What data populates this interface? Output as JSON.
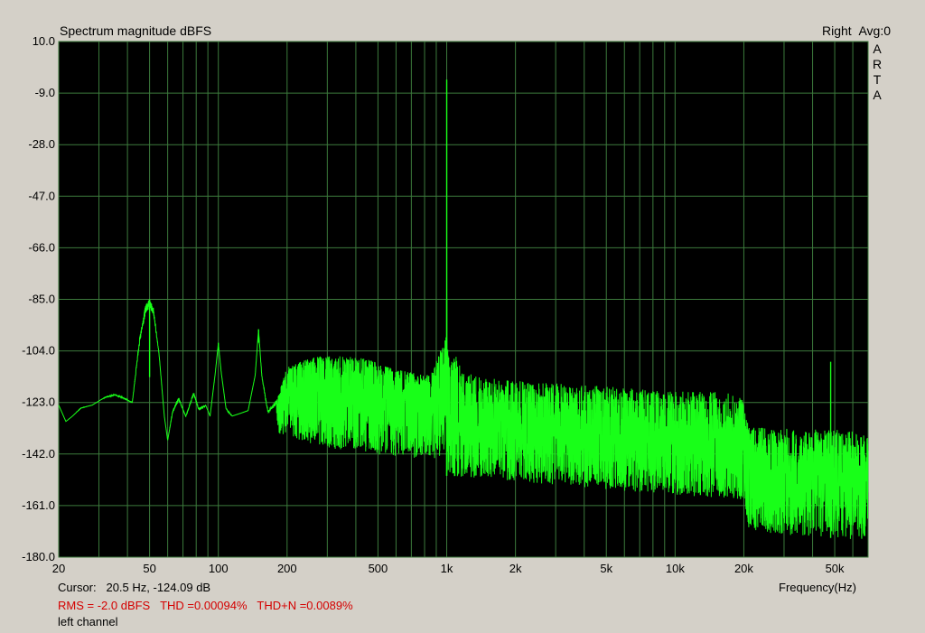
{
  "header": {
    "title": "Spectrum magnitude dBFS",
    "channel": "Right",
    "avg": "Avg:0",
    "brand_letters": [
      "A",
      "R",
      "T",
      "A"
    ]
  },
  "footer": {
    "cursor_label": "Cursor:",
    "cursor_value": "20.5 Hz, -124.09 dB",
    "rms": "RMS =   -2.0 dBFS",
    "thd": "THD =0.00094%",
    "thdn": "THD+N =0.0089%",
    "channel_label": "left channel"
  },
  "colors": {
    "plot_background": "#000000",
    "grid": "#3c7a3c",
    "trace": "#18ff18",
    "stats_text": "#d40000",
    "window_background": "#d4d0c8"
  },
  "chart_data": {
    "type": "line",
    "title": "Spectrum magnitude dBFS",
    "xlabel": "Frequency(Hz)",
    "ylabel": "",
    "x_scale": "log",
    "xlim": [
      20,
      70000
    ],
    "ylim": [
      -180,
      10
    ],
    "grid": true,
    "x_ticks": [
      {
        "value": 20,
        "label": "20"
      },
      {
        "value": 50,
        "label": "50"
      },
      {
        "value": 100,
        "label": "100"
      },
      {
        "value": 200,
        "label": "200"
      },
      {
        "value": 500,
        "label": "500"
      },
      {
        "value": 1000,
        "label": "1k"
      },
      {
        "value": 2000,
        "label": "2k"
      },
      {
        "value": 5000,
        "label": "5k"
      },
      {
        "value": 10000,
        "label": "10k"
      },
      {
        "value": 20000,
        "label": "20k"
      },
      {
        "value": 50000,
        "label": "50k"
      }
    ],
    "y_ticks": [
      {
        "value": 10,
        "label": "10.0"
      },
      {
        "value": -9,
        "label": "-9.0"
      },
      {
        "value": -28,
        "label": "-28.0"
      },
      {
        "value": -47,
        "label": "-47.0"
      },
      {
        "value": -66,
        "label": "-66.0"
      },
      {
        "value": -85,
        "label": "-85.0"
      },
      {
        "value": -104,
        "label": "-104.0"
      },
      {
        "value": -123,
        "label": "-123.0"
      },
      {
        "value": -142,
        "label": "-142.0"
      },
      {
        "value": -161,
        "label": "-161.0"
      },
      {
        "value": -180,
        "label": "-180.0"
      }
    ],
    "envelope": [
      [
        20,
        -124
      ],
      [
        21.5,
        -130
      ],
      [
        23,
        -128
      ],
      [
        25,
        -125
      ],
      [
        28,
        -124
      ],
      [
        32,
        -121
      ],
      [
        35,
        -120
      ],
      [
        38,
        -121
      ],
      [
        42,
        -123
      ],
      [
        45,
        -100
      ],
      [
        48,
        -87
      ],
      [
        50,
        -85
      ],
      [
        52,
        -88
      ],
      [
        55,
        -105
      ],
      [
        58,
        -128
      ],
      [
        60,
        -137
      ],
      [
        63,
        -126
      ],
      [
        67,
        -121
      ],
      [
        72,
        -128
      ],
      [
        78,
        -119
      ],
      [
        82,
        -125
      ],
      [
        88,
        -124
      ],
      [
        92,
        -128
      ],
      [
        97,
        -112
      ],
      [
        100,
        -101
      ],
      [
        103,
        -112
      ],
      [
        108,
        -125
      ],
      [
        115,
        -128
      ],
      [
        125,
        -127
      ],
      [
        135,
        -126
      ],
      [
        145,
        -113
      ],
      [
        150,
        -96
      ],
      [
        155,
        -113
      ],
      [
        165,
        -126
      ],
      [
        180,
        -122
      ],
      [
        200,
        -110
      ],
      [
        230,
        -108
      ],
      [
        270,
        -106
      ],
      [
        320,
        -106
      ],
      [
        380,
        -106
      ],
      [
        450,
        -107
      ],
      [
        550,
        -110
      ],
      [
        700,
        -112
      ],
      [
        850,
        -113
      ],
      [
        1000,
        -98
      ],
      [
        1150,
        -110
      ],
      [
        1500,
        -114
      ],
      [
        2000,
        -115
      ],
      [
        3000,
        -116
      ],
      [
        5000,
        -117
      ],
      [
        10000,
        -119
      ],
      [
        15000,
        -119
      ],
      [
        19500,
        -120
      ],
      [
        21000,
        -132
      ],
      [
        25000,
        -132
      ],
      [
        40000,
        -133
      ],
      [
        56000,
        -133
      ],
      [
        70000,
        -134
      ]
    ],
    "floor": [
      [
        20,
        -124
      ],
      [
        23,
        -128
      ],
      [
        30,
        -122
      ],
      [
        42,
        -124
      ],
      [
        55,
        -108
      ],
      [
        60,
        -137
      ],
      [
        70,
        -130
      ],
      [
        85,
        -132
      ],
      [
        100,
        -104
      ],
      [
        110,
        -132
      ],
      [
        150,
        -101
      ],
      [
        160,
        -132
      ],
      [
        200,
        -140
      ],
      [
        300,
        -146
      ],
      [
        500,
        -148
      ],
      [
        1000,
        -150
      ],
      [
        2000,
        -152
      ],
      [
        5000,
        -155
      ],
      [
        10000,
        -157
      ],
      [
        19500,
        -159
      ],
      [
        21000,
        -170
      ],
      [
        30000,
        -172
      ],
      [
        50000,
        -173
      ],
      [
        70000,
        -174
      ]
    ],
    "peaks": [
      {
        "x": 50,
        "y": -85
      },
      {
        "x": 100,
        "y": -101
      },
      {
        "x": 150,
        "y": -96
      },
      {
        "x": 1000,
        "y": -4
      },
      {
        "x": 1000,
        "y": -85
      },
      {
        "x": 48000,
        "y": -108
      }
    ],
    "cursor": {
      "x": 20.5,
      "y": -124.09
    }
  }
}
